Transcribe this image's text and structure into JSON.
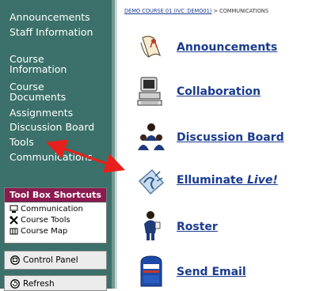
{
  "sidebar": {
    "items": [
      {
        "label": "Announcements"
      },
      {
        "label": "Staff Information"
      },
      {
        "label": "Course Information"
      },
      {
        "label": "Course Documents"
      },
      {
        "label": "Assignments"
      },
      {
        "label": "Discussion Board"
      },
      {
        "label": "Tools"
      },
      {
        "label": "Communications"
      }
    ],
    "toolbox": {
      "title": "Tool Box Shortcuts",
      "items": [
        {
          "label": "Communication",
          "icon": "monitor-icon"
        },
        {
          "label": "Course Tools",
          "icon": "tools-icon"
        },
        {
          "label": "Course Map",
          "icon": "map-icon"
        }
      ]
    },
    "control_panel": "Control Panel",
    "refresh": "Refresh"
  },
  "breadcrumb": {
    "course": "DEMO COURSE 01 (IVC_DEMO01)",
    "separator": ">",
    "current": "COMMUNICATIONS"
  },
  "tools": [
    {
      "label": "Announcements",
      "icon": "announcement-scroll-icon"
    },
    {
      "label": "Collaboration",
      "icon": "computer-icon"
    },
    {
      "label": "Discussion Board",
      "icon": "discussion-people-icon"
    },
    {
      "label": "Elluminate",
      "label_italic": "Live!",
      "icon": "elluminate-icon"
    },
    {
      "label": "Roster",
      "icon": "roster-person-icon"
    },
    {
      "label": "Send Email",
      "icon": "mailbox-icon"
    }
  ],
  "colors": {
    "sidebar_bg": "#3b716a",
    "toolbox_title_bg": "#8b1a4f",
    "link": "#1a3b8f",
    "arrow": "#e8201c"
  }
}
